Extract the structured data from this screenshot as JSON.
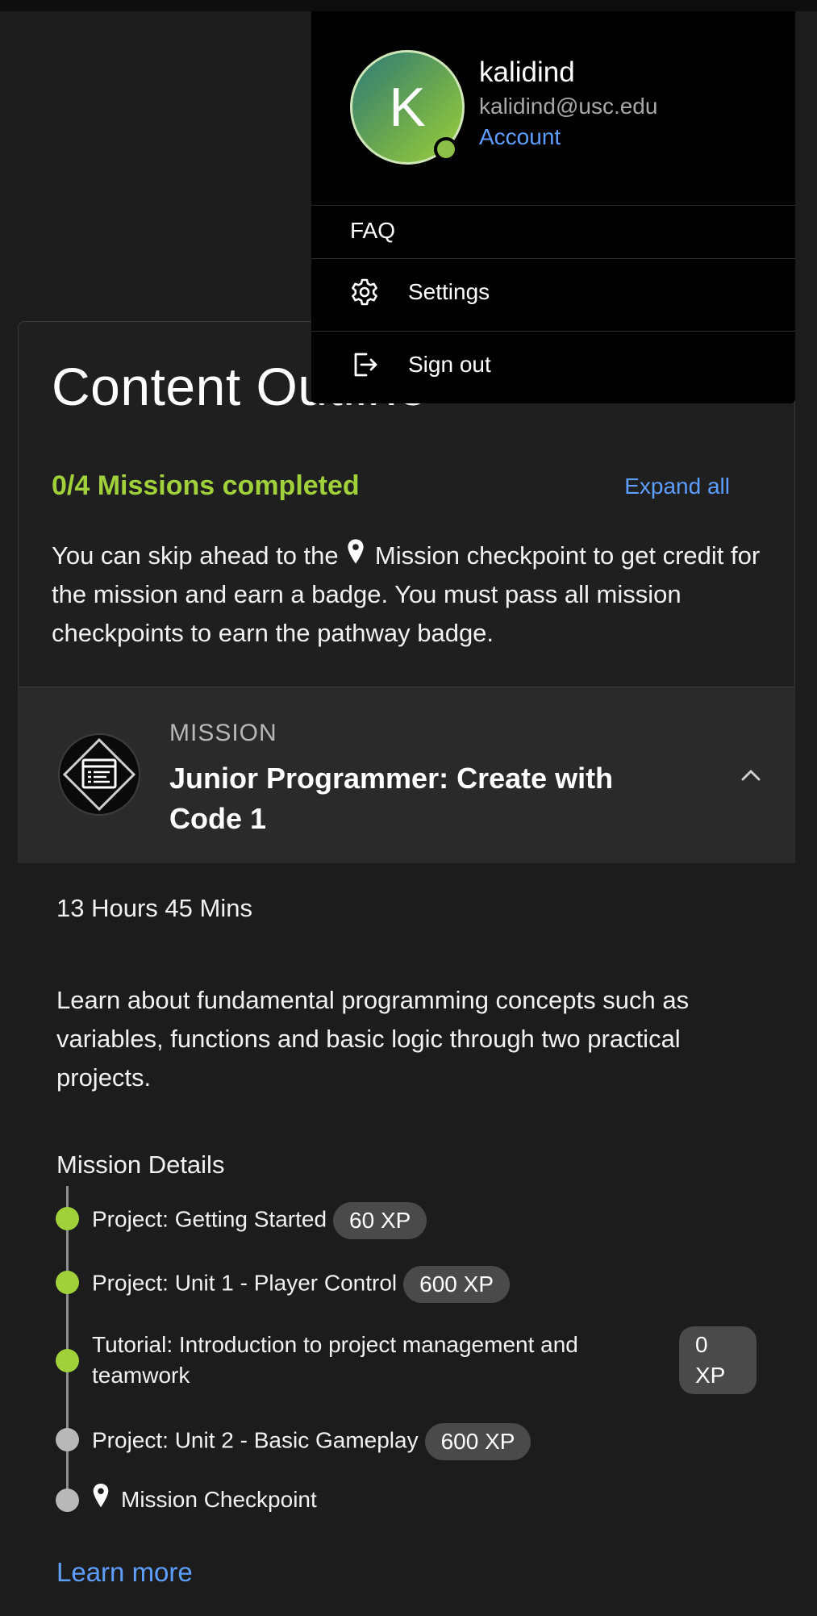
{
  "card": {
    "title": "Content Outline",
    "progress": "0/4 Missions completed",
    "expand_label": "Expand all",
    "skip_text_before": "You can skip ahead to the",
    "skip_text_after": "Mission checkpoint to get credit for the mission and earn a badge. You must pass all mission checkpoints to earn the pathway badge."
  },
  "mission": {
    "label": "MISSION",
    "title": "Junior Programmer: Create with Code 1",
    "badge_icon": "mission-badge-icon",
    "duration": "13 Hours 45 Mins",
    "description": "Learn about fundamental programming concepts such as variables, functions and basic logic through two practical projects.",
    "details_heading": "Mission Details",
    "steps": [
      {
        "title": "Project: Getting Started",
        "xp": "60 XP",
        "status": "completed"
      },
      {
        "title": "Project: Unit 1 - Player Control",
        "xp": "600 XP",
        "status": "completed"
      },
      {
        "title_line1": "Tutorial: Introduction to project management and",
        "title_line2": "teamwork",
        "xp_line1": "0",
        "xp_line2": "XP",
        "status": "completed"
      },
      {
        "title": "Project: Unit 2 - Basic Gameplay",
        "xp": "600 XP",
        "status": "not-started"
      },
      {
        "title": "Mission Checkpoint",
        "status": "not-started",
        "icon": "pin-icon"
      }
    ],
    "learn_more": "Learn more"
  },
  "user_menu": {
    "avatar_initial": "K",
    "username": "kalidind",
    "email": "kalidind@usc.edu",
    "account_label": "Account",
    "items": [
      {
        "label": "FAQ"
      },
      {
        "label": "Settings",
        "icon": "gear-icon"
      },
      {
        "label": "Sign out",
        "icon": "sign-out-icon"
      }
    ]
  },
  "colors": {
    "accent_green": "#a0d13b",
    "link_blue": "#5d9eff",
    "background": "#1c1c1c"
  }
}
